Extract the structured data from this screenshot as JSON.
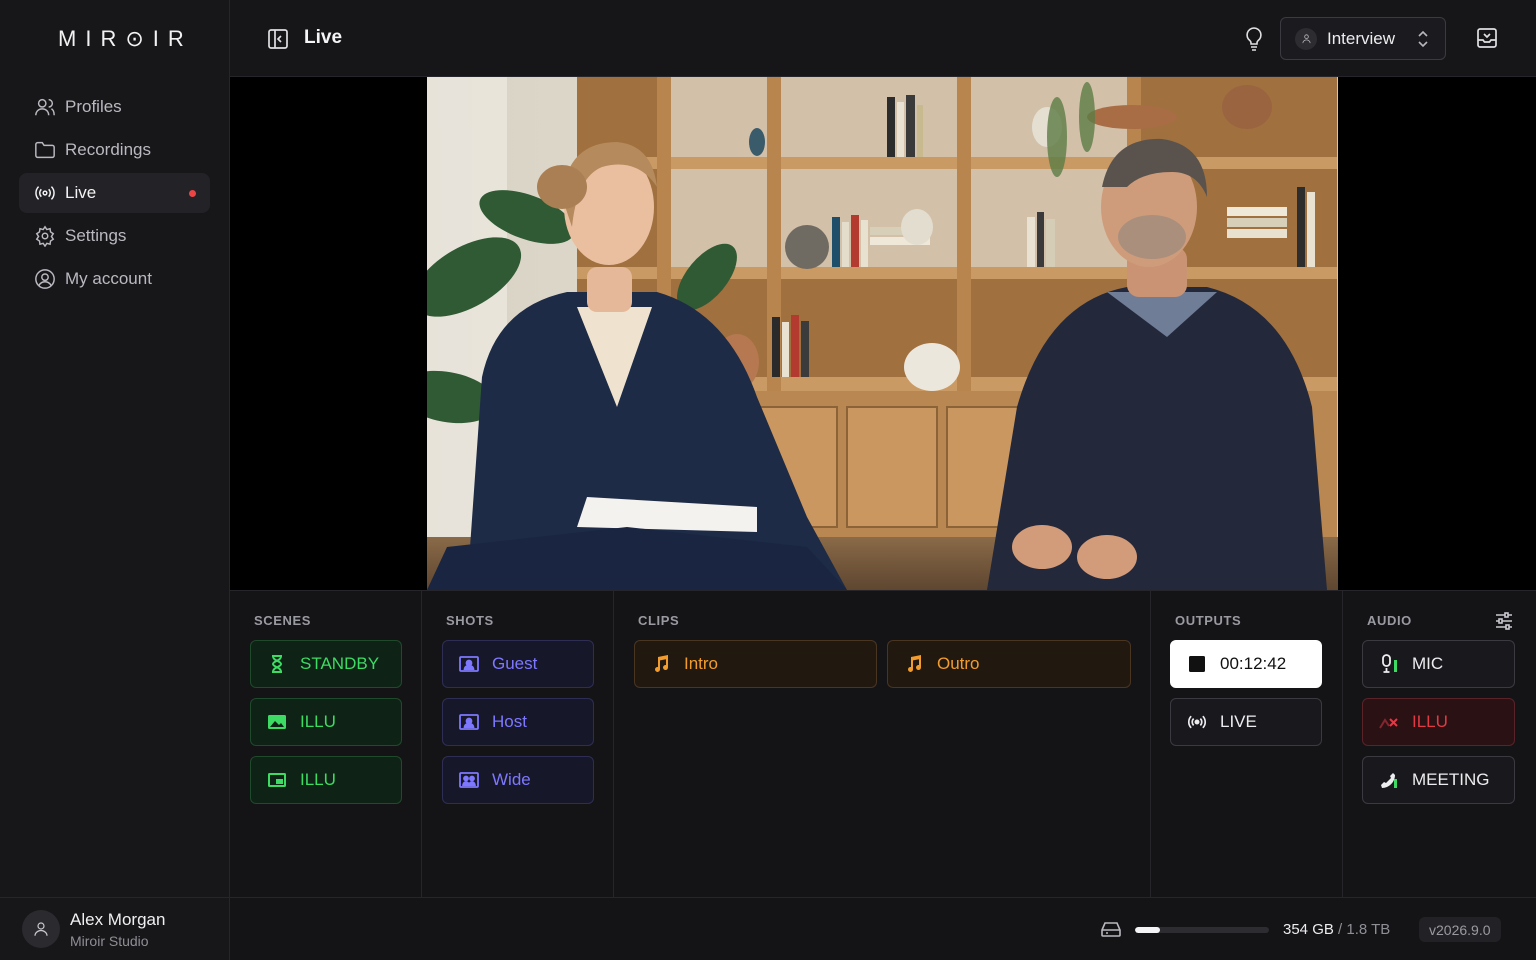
{
  "app": {
    "logo": "MIR⊙IR"
  },
  "sidebar": {
    "items": [
      {
        "label": "Profiles",
        "icon": "user-icon"
      },
      {
        "label": "Recordings",
        "icon": "folder-icon"
      },
      {
        "label": "Live",
        "icon": "broadcast-icon",
        "active": true,
        "indicator": "live-dot"
      },
      {
        "label": "Settings",
        "icon": "gear-icon"
      },
      {
        "label": "My account",
        "icon": "user-circle-icon"
      }
    ]
  },
  "user": {
    "name": "Alex Morgan",
    "org": "Miroir Studio"
  },
  "header": {
    "title": "Live",
    "profile_select": "Interview"
  },
  "panel": {
    "scenes": {
      "label": "SCENES",
      "buttons": [
        {
          "label": "STANDBY",
          "icon": "hourglass-icon"
        },
        {
          "label": "ILLU",
          "icon": "image-icon"
        },
        {
          "label": "ILLU",
          "icon": "picture-in-picture-icon"
        }
      ]
    },
    "shots": {
      "label": "SHOTS",
      "buttons": [
        {
          "label": "Guest",
          "icon": "portrait-icon"
        },
        {
          "label": "Host",
          "icon": "portrait-icon"
        },
        {
          "label": "Wide",
          "icon": "group-icon"
        }
      ]
    },
    "clips": {
      "label": "CLIPS",
      "buttons": [
        {
          "label": "Intro",
          "icon": "music-note-icon"
        },
        {
          "label": "Outro",
          "icon": "music-note-icon"
        }
      ]
    },
    "outputs": {
      "label": "OUTPUTS",
      "record_time": "00:12:42",
      "live_label": "LIVE"
    },
    "audio": {
      "label": "AUDIO",
      "buttons": [
        {
          "label": "MIC",
          "icon": "microphone-icon"
        },
        {
          "label": "ILLU",
          "icon": "muted-image-icon",
          "muted": true
        },
        {
          "label": "MEETING",
          "icon": "phone-icon"
        }
      ]
    }
  },
  "footer": {
    "storage_used": "354 GB",
    "storage_sep": " / ",
    "storage_total": "1.8 TB",
    "storage_fraction": 0.19,
    "version": "v2026.9.0"
  },
  "colors": {
    "scene_green": "#3ddb63",
    "shot_purple": "#7d78ff",
    "clip_orange": "#f29c2e",
    "mute_red": "#e03a45",
    "live_dot": "#ef4444"
  }
}
